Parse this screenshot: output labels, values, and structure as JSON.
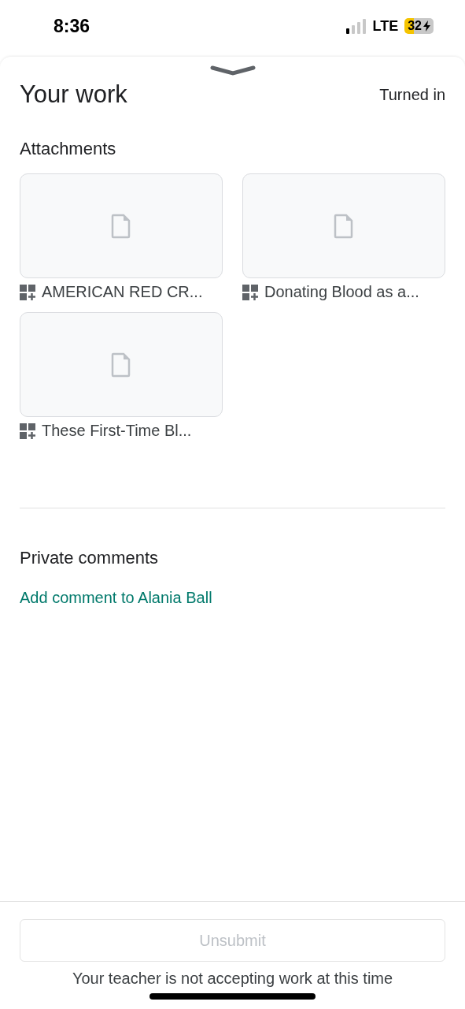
{
  "status_bar": {
    "time": "8:36",
    "network": "LTE",
    "battery": "32"
  },
  "header": {
    "title": "Your work",
    "status": "Turned in"
  },
  "attachments": {
    "heading": "Attachments",
    "items": [
      {
        "name": "AMERICAN RED CR..."
      },
      {
        "name": "Donating Blood as a..."
      },
      {
        "name": "These First-Time Bl..."
      }
    ]
  },
  "private_comments": {
    "heading": "Private comments",
    "link": "Add comment to Alania Ball"
  },
  "footer": {
    "button": {
      "label": "Unsubmit",
      "disabled": true
    },
    "note": "Your teacher is not accepting work at this time"
  }
}
